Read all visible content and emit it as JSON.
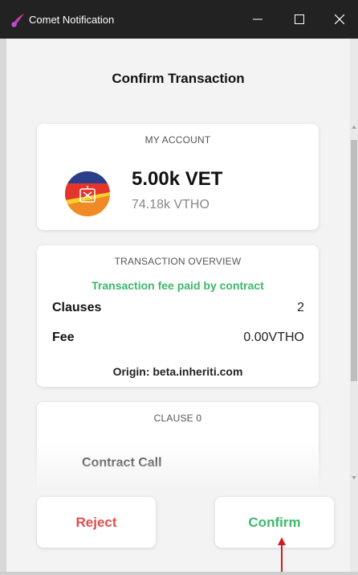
{
  "window": {
    "title": "Comet Notification",
    "icon": "comet-icon",
    "controls": [
      "minimize-icon",
      "maximize-icon",
      "close-icon"
    ]
  },
  "page": {
    "title": "Confirm Transaction"
  },
  "account": {
    "header": "MY ACCOUNT",
    "balance": "5.00k VET",
    "sub_balance": "74.18k VTHO"
  },
  "overview": {
    "header": "TRANSACTION OVERVIEW",
    "fee_note": "Transaction fee paid by contract",
    "rows": [
      {
        "label": "Clauses",
        "value": "2"
      },
      {
        "label": "Fee",
        "value": "0.00VTHO"
      }
    ],
    "origin": "Origin: beta.inheriti.com"
  },
  "clause": {
    "header": "CLAUSE 0",
    "type": "Contract Call"
  },
  "actions": {
    "reject_label": "Reject",
    "confirm_label": "Confirm"
  },
  "colors": {
    "titlebar": "#222222",
    "accent_green": "#3cb86a",
    "reject_red": "#e04e4e",
    "annotation_arrow": "#d61a1a"
  }
}
